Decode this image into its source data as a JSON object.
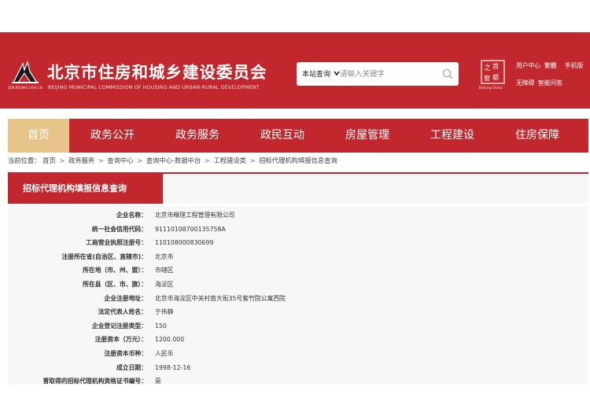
{
  "header": {
    "title": "北京市住房和城乡建设委员会",
    "subtitle": "BEIJING MUNICIPAL COMMISSION OF HOUSING AND URBAN-RURAL DEVELOPMENT",
    "emblem_url": "ZJW.BEIJING.GOV.CN",
    "capital_logo_caption": "Beijing·China",
    "colors": {
      "brand": "#c1272d",
      "nav_active": "#e8c38a"
    }
  },
  "search": {
    "scope": "本站查询",
    "placeholder": "请输入关键字"
  },
  "top_links": {
    "user_center": "用户中心",
    "traditional": "繁體",
    "mobile": "手机版",
    "accessibility": "无障碍",
    "smart_qa": "智能问答"
  },
  "nav": {
    "items": [
      "首页",
      "政务公开",
      "政务服务",
      "政民互动",
      "房屋管理",
      "工程建设",
      "住房保障"
    ],
    "active_index": 0
  },
  "breadcrumb": {
    "prefix": "当前位置：",
    "items": [
      "首页",
      "政务服务",
      "查询中心",
      "查询中心-数据中台",
      "工程建设类",
      "招标代理机构填报信息查询"
    ]
  },
  "panel": {
    "title": "招标代理机构填报信息查询"
  },
  "details": [
    {
      "label": "企业名称：",
      "value": "北京市精理工程管理有限公司"
    },
    {
      "label": "统一社会信用代码：",
      "value": "91110108700135758A"
    },
    {
      "label": "工商营业执照注册号：",
      "value": "110108000830699"
    },
    {
      "label": "注册所在省(自治区、直辖市)：",
      "value": "北京市"
    },
    {
      "label": "所在地（市、州、盟）：",
      "value": "市辖区"
    },
    {
      "label": "所在县（区、市、旗）：",
      "value": "海淀区"
    },
    {
      "label": "企业注册地址：",
      "value": "北京市海淀区中关村南大街35号紫竹院公寓西院"
    },
    {
      "label": "法定代表人姓名：",
      "value": "于伟静"
    },
    {
      "label": "企业登记注册类型：",
      "value": "150"
    },
    {
      "label": "注册资本（万元）：",
      "value": "1200.000"
    },
    {
      "label": "注册资本币种：",
      "value": "人民币"
    },
    {
      "label": "成立日期：",
      "value": "1998-12-16"
    },
    {
      "label": "曾取得的招标代理机构资格证书编号：",
      "value": "是"
    }
  ]
}
